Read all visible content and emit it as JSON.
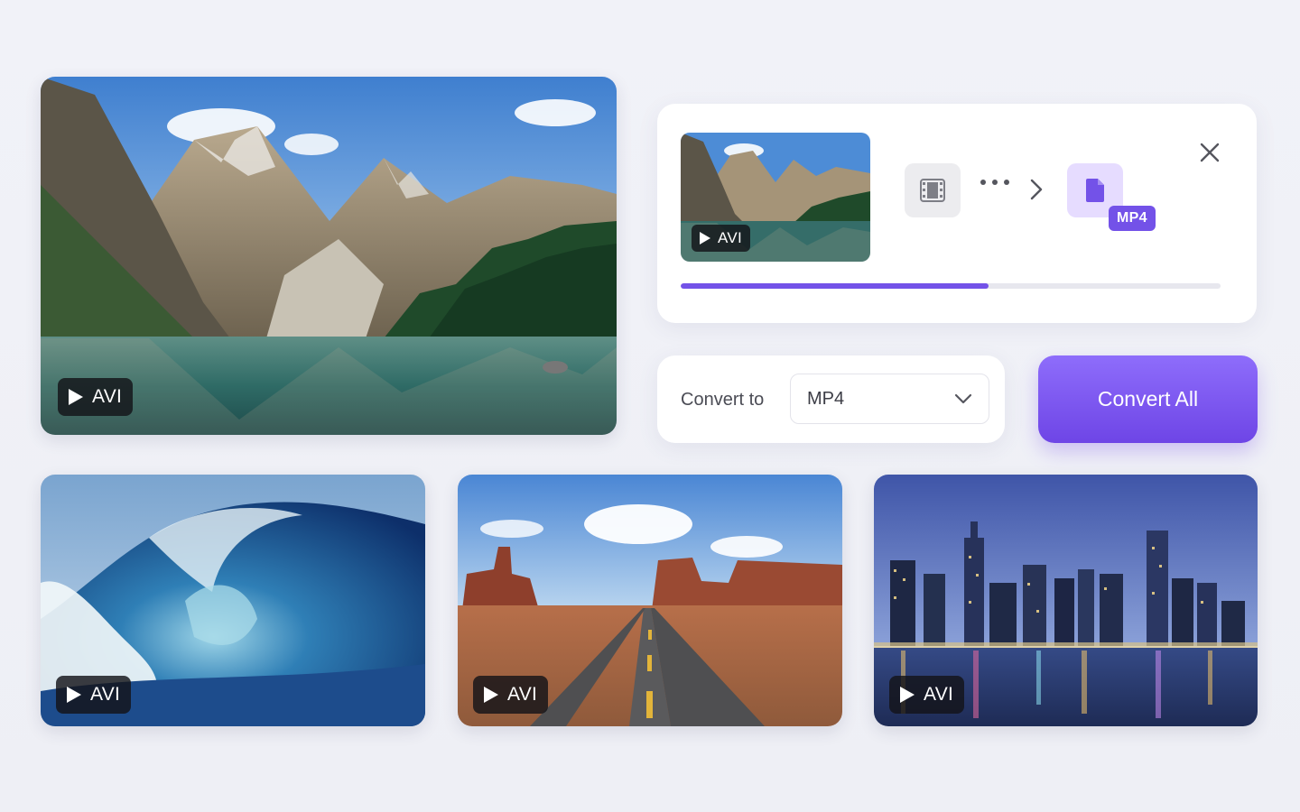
{
  "hero_video": {
    "format_badge": "AVI"
  },
  "conversion_card": {
    "thumbnail_badge": "AVI",
    "target_format": "MP4",
    "progress": 0.57
  },
  "convert_panel": {
    "label": "Convert to",
    "selected_format": "MP4"
  },
  "convert_all_button": "Convert All",
  "gallery": [
    {
      "scene": "ocean-wave",
      "format_badge": "AVI"
    },
    {
      "scene": "desert-road",
      "format_badge": "AVI"
    },
    {
      "scene": "city-skyline",
      "format_badge": "AVI"
    }
  ],
  "colors": {
    "accent": "#7352e8",
    "accent_light": "#e6dcff",
    "background": "#f0f1f7"
  },
  "icons": [
    "play-icon",
    "film-icon",
    "more-dots-icon",
    "chevron-right-icon",
    "file-icon",
    "close-icon",
    "chevron-down-icon"
  ]
}
